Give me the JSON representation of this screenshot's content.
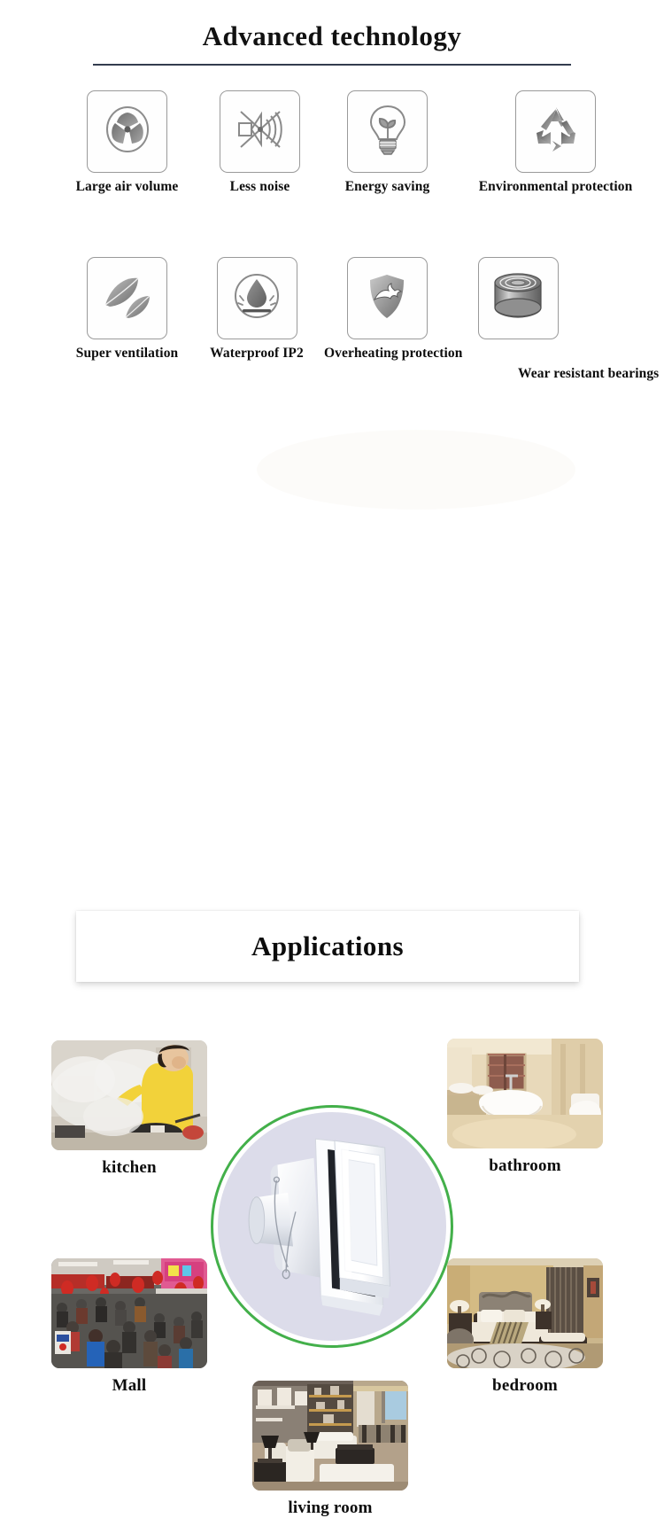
{
  "tech": {
    "title": "Advanced technology",
    "features_row1": [
      {
        "label": "Large air volume",
        "icon": "fan-blades-icon"
      },
      {
        "label": "Less noise",
        "icon": "no-noise-icon"
      },
      {
        "label": "Energy saving",
        "icon": "lightbulb-leaf-icon"
      },
      {
        "label": "Environmental protection",
        "icon": "recycling-icon"
      }
    ],
    "features_row2": [
      {
        "label": "Super ventilation",
        "icon": "leaves-icon"
      },
      {
        "label": "Waterproof  IP2",
        "icon": "waterdrop-icon"
      },
      {
        "label": "Overheating protection",
        "icon": "shield-flame-icon"
      },
      {
        "label": "Wear resistant bearings",
        "icon": "bearing-icon"
      }
    ]
  },
  "applications": {
    "title": "Applications",
    "product": {
      "name": "wall-mounted-exhaust-fan",
      "ring_color": "#43b04a",
      "disc_color": "#dcdcea"
    },
    "items": [
      {
        "label": "kitchen",
        "scene": "kitchen-smoke-wok"
      },
      {
        "label": "bathroom",
        "scene": "beige-bathroom-bathtub"
      },
      {
        "label": "Mall",
        "scene": "crowded-shopping-mall"
      },
      {
        "label": "bedroom",
        "scene": "luxury-hotel-bedroom"
      },
      {
        "label": "living room",
        "scene": "modern-living-room"
      }
    ]
  },
  "colors": {
    "rule": "#333c4e",
    "icon_border": "#9a9a9a",
    "icon_gray_dark": "#6b6b6b",
    "icon_gray_light": "#b8b8b8",
    "text": "#0c0c0c"
  }
}
